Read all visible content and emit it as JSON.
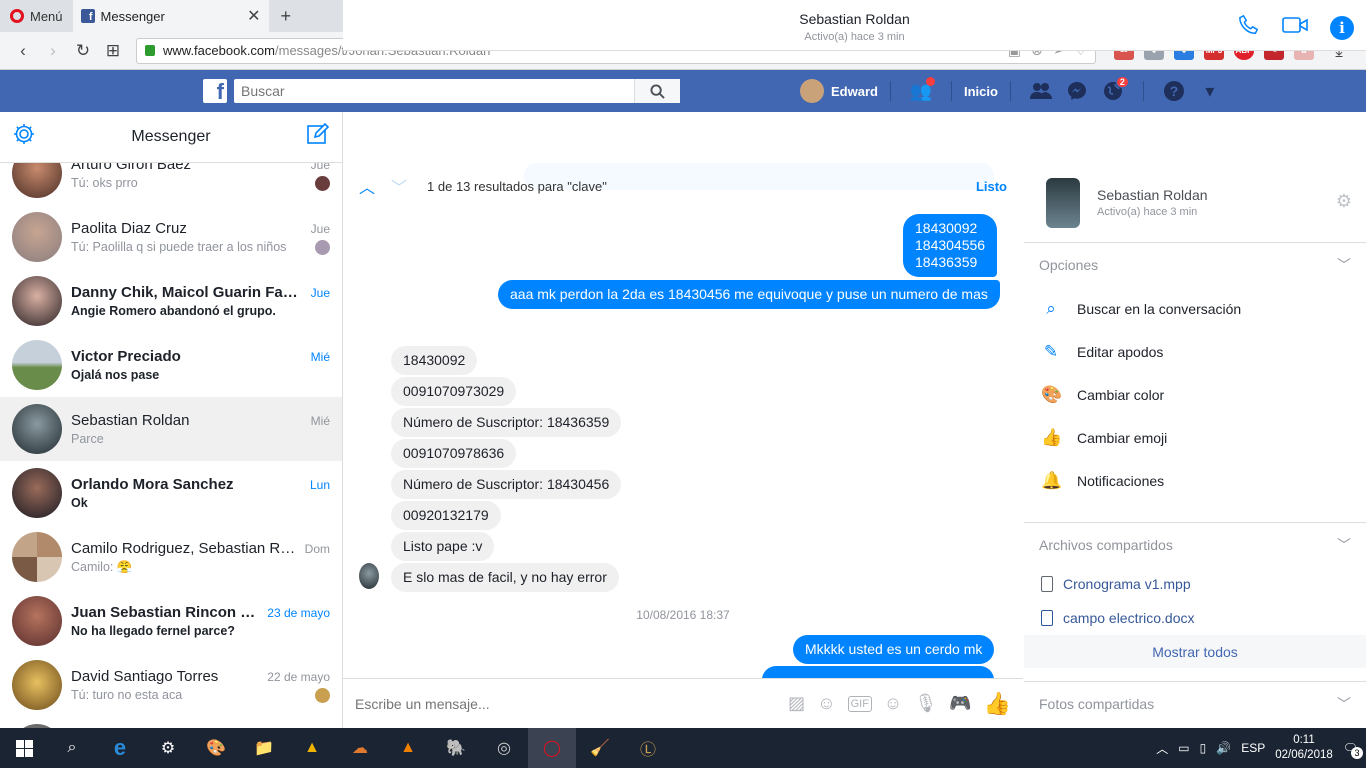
{
  "browser": {
    "menu_label": "Menú",
    "tab_title": "Messenger",
    "url_domain": "www.facebook.com",
    "url_path": "/messages/t/Johan.Sebastian.Roldan",
    "ext_badge": "19",
    "ext_mp3": "MP3",
    "ext_abp": "ABP"
  },
  "fb": {
    "search_placeholder": "Buscar",
    "user_name": "Edward",
    "home_label": "Inicio",
    "notif_count": "2"
  },
  "sidebar": {
    "title": "Messenger",
    "conversations": [
      {
        "name": "Arturo Giron Baez",
        "time": "Jue",
        "preview": "Tú: oks prro",
        "unread": false
      },
      {
        "name": "Paolita Diaz Cruz",
        "time": "Jue",
        "preview": "Tú: Paolilla q si puede traer a los niños",
        "unread": false
      },
      {
        "name": "Danny Chik, Maicol Guarin Fand...",
        "time": "Jue",
        "preview": "Angie Romero abandonó el grupo.",
        "unread": true
      },
      {
        "name": "Victor Preciado",
        "time": "Mié",
        "preview": "Ojalá nos pase",
        "unread": true
      },
      {
        "name": "Sebastian Roldan",
        "time": "Mié",
        "preview": "Parce",
        "unread": false,
        "selected": true
      },
      {
        "name": "Orlando Mora Sanchez",
        "time": "Lun",
        "preview": "Ok",
        "unread": true
      },
      {
        "name": "Camilo Rodriguez, Sebastian Rol...",
        "time": "Dom",
        "preview": "Camilo: 😤",
        "unread": false
      },
      {
        "name": "Juan Sebastian Rincon C...",
        "time": "23 de mayo",
        "preview": "No ha llegado fernel parce?",
        "unread": true
      },
      {
        "name": "David Santiago Torres",
        "time": "22 de mayo",
        "preview": "Tú: turo no esta aca",
        "unread": false
      }
    ]
  },
  "chat": {
    "name": "Sebastian Roldan",
    "status": "Activo(a) hace 3 min",
    "find_text": "1 de 13 resultados para \"clave\"",
    "find_done": "Listo",
    "messages": [
      {
        "dir": "out",
        "text": "18430092"
      },
      {
        "dir": "out",
        "text": "184304556"
      },
      {
        "dir": "out",
        "text": "18436359"
      },
      {
        "dir": "out",
        "text": "aaa mk perdon la 2da es 18430456 me equivoque y puse un numero de mas"
      },
      {
        "dir": "in",
        "text": "18430092"
      },
      {
        "dir": "in",
        "text": "0091070973029"
      },
      {
        "dir": "in",
        "text": "Número de Suscriptor: 18436359"
      },
      {
        "dir": "in",
        "text": "0091070978636"
      },
      {
        "dir": "in",
        "text": "Número de Suscriptor: 18430456"
      },
      {
        "dir": "in",
        "text": "00920132179"
      },
      {
        "dir": "in",
        "text": "Listo pape :v"
      },
      {
        "dir": "in",
        "text": "E slo mas de facil, y no hay error"
      },
      {
        "dir": "out",
        "text": "Mkkkk usted es un cerdo mk"
      }
    ],
    "timestamp": "10/08/2016 18:37",
    "composer_placeholder": "Escribe un mensaje...",
    "gif_label": "GIF"
  },
  "details": {
    "name": "Sebastian Roldan",
    "status": "Activo(a) hace 3 min",
    "options_title": "Opciones",
    "options": [
      {
        "label": "Buscar en la conversación",
        "icon": "search-icon"
      },
      {
        "label": "Editar apodos",
        "icon": "pencil-icon"
      },
      {
        "label": "Cambiar color",
        "icon": "palette-icon"
      },
      {
        "label": "Cambiar emoji",
        "icon": "thumbs-up-icon"
      },
      {
        "label": "Notificaciones",
        "icon": "bell-icon"
      }
    ],
    "files_title": "Archivos compartidos",
    "files": [
      "Cronograma v1.mpp",
      "campo electrico.docx"
    ],
    "show_all": "Mostrar todos",
    "photos_title": "Fotos compartidas"
  },
  "taskbar": {
    "lang": "ESP",
    "time": "0:11",
    "date": "02/06/2018",
    "notif_count": "3"
  },
  "colors": {
    "fb_blue": "#4267b2",
    "messenger_blue": "#0084ff",
    "taskbar": "#1b2432"
  }
}
